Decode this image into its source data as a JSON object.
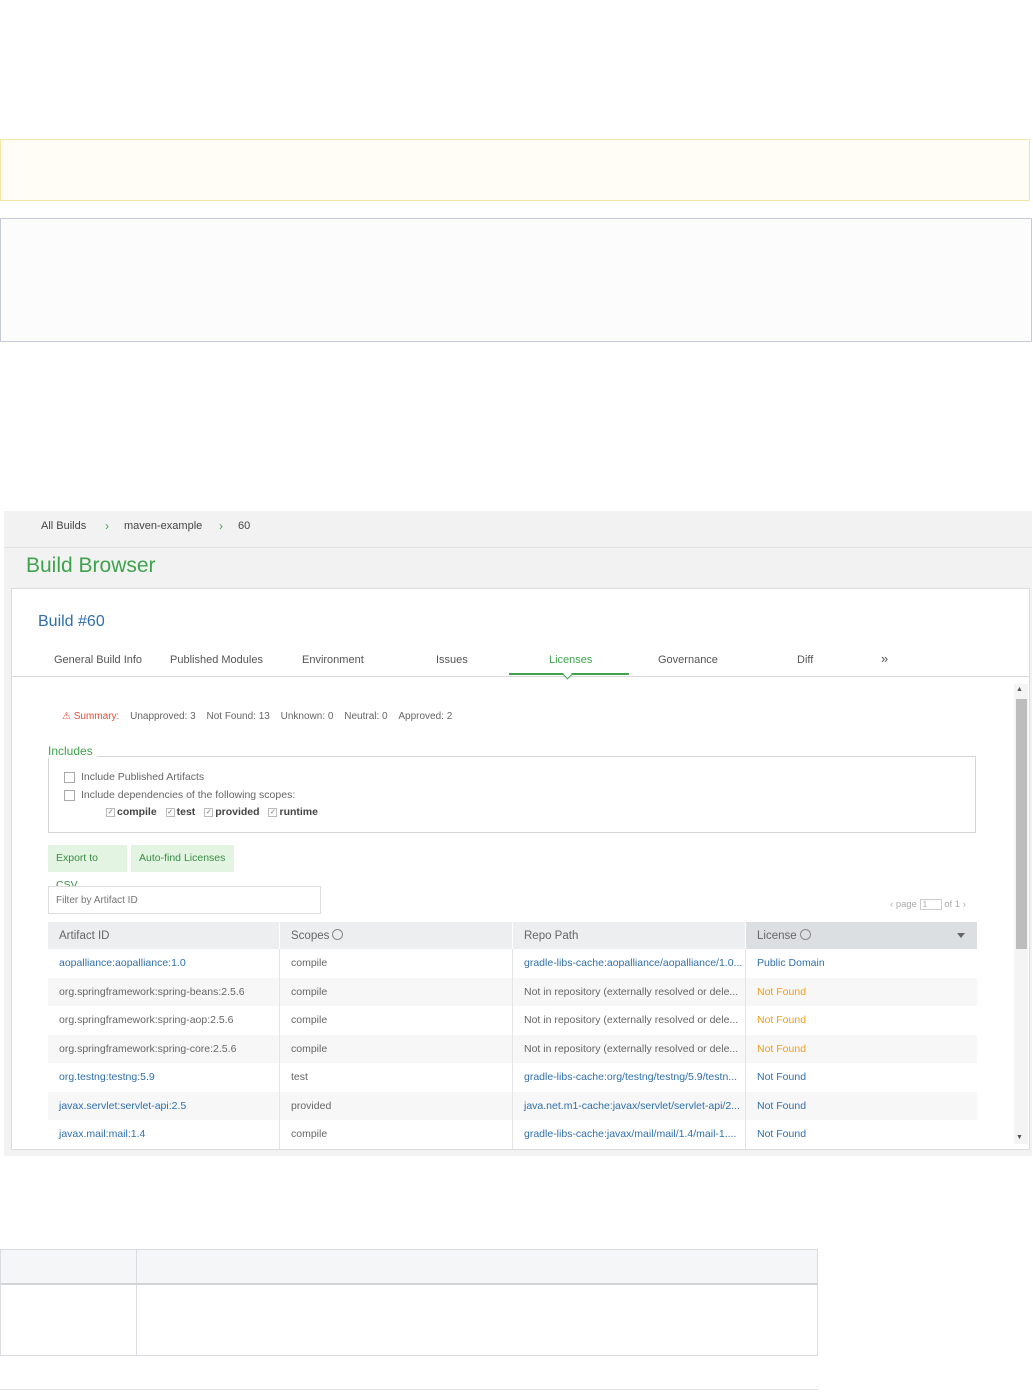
{
  "breadcrumb": {
    "items": [
      "All Builds",
      "maven-example",
      "60"
    ],
    "separator": "›"
  },
  "page_title": "Build Browser",
  "build_title": "Build #60",
  "tabs": [
    {
      "label": "General Build Info"
    },
    {
      "label": "Published Modules"
    },
    {
      "label": "Environment"
    },
    {
      "label": "Issues"
    },
    {
      "label": "Licenses",
      "active": true
    },
    {
      "label": "Governance"
    },
    {
      "label": "Diff"
    },
    {
      "label": "»"
    }
  ],
  "summary": {
    "label": "Summary:",
    "unapproved": "Unapproved: 3",
    "not_found": "Not Found: 13",
    "unknown": "Unknown: 0",
    "neutral": "Neutral: 0",
    "approved": "Approved: 2"
  },
  "includes": {
    "title": "Includes",
    "published_artifacts": "Include Published Artifacts",
    "dependencies_scopes": "Include dependencies of the following scopes:",
    "scopes": [
      "compile",
      "test",
      "provided",
      "runtime"
    ]
  },
  "buttons": {
    "export_csv": "Export to CSV",
    "auto_find": "Auto-find Licenses"
  },
  "filter": {
    "placeholder": "Filter by Artifact ID"
  },
  "pager": {
    "prefix": "page",
    "current": "1",
    "suffix": "of 1"
  },
  "grid": {
    "columns": [
      "Artifact ID",
      "Scopes",
      "Repo Path",
      "License"
    ],
    "rows": [
      {
        "artifact": "aopalliance:aopalliance:1.0",
        "scope": "compile",
        "repo": "gradle-libs-cache:aopalliance/aopalliance/1.0...",
        "license": "Public Domain",
        "artifact_link": true,
        "repo_link": true,
        "license_status": "link"
      },
      {
        "artifact": "org.springframework:spring-beans:2.5.6",
        "scope": "compile",
        "repo": "Not in repository (externally resolved or dele...",
        "license": "Not Found",
        "artifact_link": false,
        "repo_link": false,
        "license_status": "warn"
      },
      {
        "artifact": "org.springframework:spring-aop:2.5.6",
        "scope": "compile",
        "repo": "Not in repository (externally resolved or dele...",
        "license": "Not Found",
        "artifact_link": false,
        "repo_link": false,
        "license_status": "warn"
      },
      {
        "artifact": "org.springframework:spring-core:2.5.6",
        "scope": "compile",
        "repo": "Not in repository (externally resolved or dele...",
        "license": "Not Found",
        "artifact_link": false,
        "repo_link": false,
        "license_status": "warn"
      },
      {
        "artifact": "org.testng:testng:5.9",
        "scope": "test",
        "repo": "gradle-libs-cache:org/testng/testng/5.9/testn...",
        "license": "Not Found",
        "artifact_link": true,
        "repo_link": true,
        "license_status": "link"
      },
      {
        "artifact": "javax.servlet:servlet-api:2.5",
        "scope": "provided",
        "repo": "java.net.m1-cache:javax/servlet/servlet-api/2...",
        "license": "Not Found",
        "artifact_link": true,
        "repo_link": true,
        "license_status": "link"
      },
      {
        "artifact": "javax.mail:mail:1.4",
        "scope": "compile",
        "repo": "gradle-libs-cache:javax/mail/mail/1.4/mail-1....",
        "license": "Not Found",
        "artifact_link": true,
        "repo_link": true,
        "license_status": "link"
      }
    ]
  },
  "colors": {
    "accent_green": "#3fa34d",
    "link_blue": "#2f6fad",
    "warning_orange": "#f39c12",
    "summary_red": "#e84c3d"
  }
}
